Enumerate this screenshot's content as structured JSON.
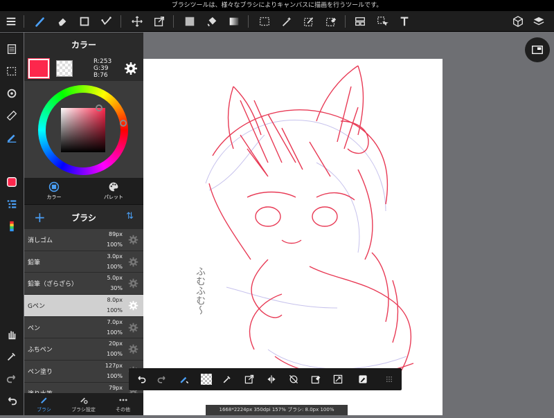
{
  "top_message": "ブラシツールは、様々なブラシによりキャンバスに描画を行うツールです。",
  "toolbar": {
    "menu_icon": "menu-icon",
    "items": [
      "brush-tool-icon",
      "eraser-tool-icon",
      "shape-tool-icon",
      "dot-tool-icon",
      "move-tool-icon",
      "transform-tool-icon",
      "fill-color-icon",
      "bucket-icon",
      "gradient-icon",
      "select-icon",
      "magic-wand-icon",
      "select-pen-icon",
      "select-eraser-icon",
      "layer-panel-icon",
      "operation-icon",
      "text-tool-icon",
      "3d-material-icon",
      "layers-icon"
    ]
  },
  "color_panel": {
    "title": "カラー",
    "main_color": "#fd274c",
    "r_label": "R:253",
    "g_label": "G:39",
    "b_label": "B:76",
    "tabs": [
      {
        "label": "カラー",
        "icon": "color-icon"
      },
      {
        "label": "パレット",
        "icon": "palette-icon"
      }
    ]
  },
  "brush_panel": {
    "title": "ブラシ",
    "items": [
      {
        "name": "消しゴム",
        "size": "89px",
        "opacity": "100%"
      },
      {
        "name": "鉛筆",
        "size": "3.0px",
        "opacity": "100%"
      },
      {
        "name": "鉛筆（ざらざら）",
        "size": "5.0px",
        "opacity": "30%"
      },
      {
        "name": "Gペン",
        "size": "8.0px",
        "opacity": "100%"
      },
      {
        "name": "ペン",
        "size": "7.0px",
        "opacity": "100%"
      },
      {
        "name": "ふちペン",
        "size": "20px",
        "opacity": "100%"
      },
      {
        "name": "ペン塗り",
        "size": "127px",
        "opacity": "100%"
      },
      {
        "name": "塗り水筆",
        "size": "79px",
        "opacity": ""
      }
    ],
    "selected_index": 3
  },
  "bottom_tabs": [
    {
      "label": "ブラシ",
      "icon": "brush-icon"
    },
    {
      "label": "ブラシ設定",
      "icon": "brush-settings-icon"
    },
    {
      "label": "その他",
      "icon": "more-icon"
    }
  ],
  "status": "1668*2224px 350dpi 157% ブラシ: 8.0px 100%",
  "canvas_text": "ふむふむ〜"
}
